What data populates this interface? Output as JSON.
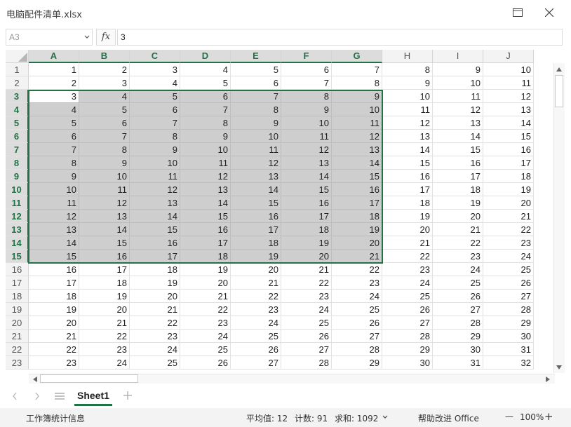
{
  "window": {
    "title": "电脑配件清单.xlsx"
  },
  "formula_bar": {
    "name_box": "A3",
    "fx_label": "fx",
    "formula_value": "3"
  },
  "grid": {
    "columns": [
      "A",
      "B",
      "C",
      "D",
      "E",
      "F",
      "G",
      "H",
      "I",
      "J"
    ],
    "rows": [
      1,
      2,
      3,
      4,
      5,
      6,
      7,
      8,
      9,
      10,
      11,
      12,
      13,
      14,
      15,
      16,
      17,
      18,
      19,
      20,
      21,
      22,
      23
    ],
    "values": [
      [
        1,
        2,
        3,
        4,
        5,
        6,
        7,
        8,
        9,
        10
      ],
      [
        2,
        3,
        4,
        5,
        6,
        7,
        8,
        9,
        10,
        11
      ],
      [
        3,
        4,
        5,
        6,
        7,
        8,
        9,
        10,
        11,
        12
      ],
      [
        4,
        5,
        6,
        7,
        8,
        9,
        10,
        11,
        12,
        13
      ],
      [
        5,
        6,
        7,
        8,
        9,
        10,
        11,
        12,
        13,
        14
      ],
      [
        6,
        7,
        8,
        9,
        10,
        11,
        12,
        13,
        14,
        15
      ],
      [
        7,
        8,
        9,
        10,
        11,
        12,
        13,
        14,
        15,
        16
      ],
      [
        8,
        9,
        10,
        11,
        12,
        13,
        14,
        15,
        16,
        17
      ],
      [
        9,
        10,
        11,
        12,
        13,
        14,
        15,
        16,
        17,
        18
      ],
      [
        10,
        11,
        12,
        13,
        14,
        15,
        16,
        17,
        18,
        19
      ],
      [
        11,
        12,
        13,
        14,
        15,
        16,
        17,
        18,
        19,
        20
      ],
      [
        12,
        13,
        14,
        15,
        16,
        17,
        18,
        19,
        20,
        21
      ],
      [
        13,
        14,
        15,
        16,
        17,
        18,
        19,
        20,
        21,
        22
      ],
      [
        14,
        15,
        16,
        17,
        18,
        19,
        20,
        21,
        22,
        23
      ],
      [
        15,
        16,
        17,
        18,
        19,
        20,
        21,
        22,
        23,
        24
      ],
      [
        16,
        17,
        18,
        19,
        20,
        21,
        22,
        23,
        24,
        25
      ],
      [
        17,
        18,
        19,
        20,
        21,
        22,
        23,
        24,
        25,
        26
      ],
      [
        18,
        19,
        20,
        21,
        22,
        23,
        24,
        25,
        26,
        27
      ],
      [
        19,
        20,
        21,
        22,
        23,
        24,
        25,
        26,
        27,
        28
      ],
      [
        20,
        21,
        22,
        23,
        24,
        25,
        26,
        27,
        28,
        29
      ],
      [
        21,
        22,
        23,
        24,
        25,
        26,
        27,
        28,
        29,
        30
      ],
      [
        22,
        23,
        24,
        25,
        26,
        27,
        28,
        29,
        30,
        31
      ],
      [
        23,
        24,
        25,
        26,
        27,
        28,
        29,
        30,
        31,
        32
      ]
    ],
    "selection": {
      "range": "A3:G15",
      "active_cell": "A3",
      "selected_columns": [
        "A",
        "B",
        "C",
        "D",
        "E",
        "F",
        "G"
      ],
      "selected_rows": [
        3,
        4,
        5,
        6,
        7,
        8,
        9,
        10,
        11,
        12,
        13,
        14,
        15
      ]
    }
  },
  "sheets": {
    "tabs": [
      {
        "label": "Sheet1",
        "active": true
      }
    ],
    "add_label": "+"
  },
  "status_bar": {
    "workbook_stats": "工作簿统计信息",
    "average": "平均值: 12",
    "count": "计数: 91",
    "sum": "求和: 1092",
    "feedback": "帮助改进 Office",
    "zoom_out": "—",
    "zoom": "100%",
    "zoom_in": "+"
  },
  "colors": {
    "accent": "#217346",
    "selection_fill": "#cecece",
    "header_fill": "#f3f3f3"
  },
  "icons": [
    "maximize-icon",
    "close-icon",
    "chevron-down-icon",
    "scroll-up-icon",
    "scroll-down-icon",
    "scroll-left-icon",
    "scroll-right-icon",
    "sheet-prev-icon",
    "sheet-next-icon",
    "sheet-list-icon",
    "add-sheet-icon",
    "sum-dropdown-icon"
  ]
}
